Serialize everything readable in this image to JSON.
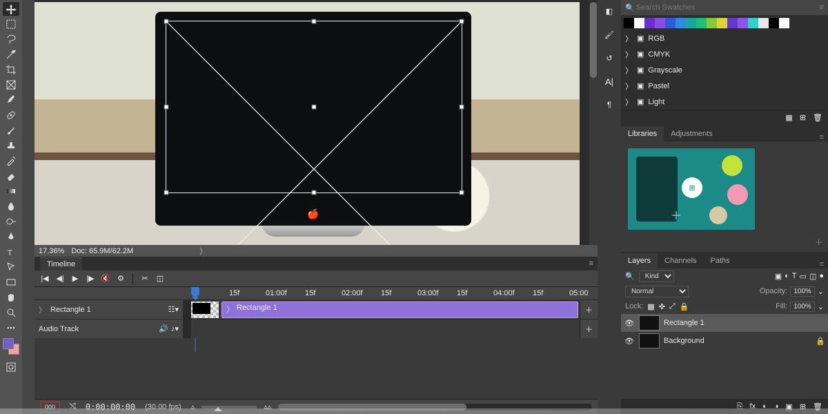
{
  "canvas": {
    "zoom": "17.36%",
    "doc_size": "Doc: 65.9M/62.2M"
  },
  "timeline": {
    "tab": "Timeline",
    "ruler": [
      "15f",
      "01:00f",
      "15f",
      "02:00f",
      "15f",
      "03:00f",
      "15f",
      "04:00f",
      "15f",
      "05:00"
    ],
    "track1": {
      "name": "Rectangle 1",
      "clip": "Rectangle 1"
    },
    "track2": {
      "name": "Audio Track"
    },
    "footer": {
      "frame_btn": "000",
      "timecode": "0:00:00:00",
      "fps": "(30.00 fps)"
    }
  },
  "swatches": {
    "search_placeholder": "Search Swatches",
    "folders": [
      "RGB",
      "CMYK",
      "Grayscale",
      "Pastel",
      "Light"
    ],
    "colors": [
      "#000000",
      "#ffffff",
      "#6a2fcf",
      "#8a4be0",
      "#2d5bd9",
      "#2f8ae0",
      "#17a7a2",
      "#1fbf7a",
      "#86c93e",
      "#e0d23a",
      "#6438cf",
      "#8f55e6",
      "#2cd3cc",
      "#e7e7e7",
      "#000000",
      "#ffffff"
    ]
  },
  "libraries": {
    "tabs": [
      "Libraries",
      "Adjustments"
    ]
  },
  "layers": {
    "tabs": [
      "Layers",
      "Channels",
      "Paths"
    ],
    "kind_placeholder": "Kind",
    "blend": "Normal",
    "opacity_label": "Opacity:",
    "opacity": "100%",
    "lock_label": "Lock:",
    "fill_label": "Fill:",
    "fill": "100%",
    "items": [
      {
        "name": "Rectangle 1",
        "selected": true,
        "locked": false
      },
      {
        "name": "Background",
        "selected": false,
        "locked": true
      }
    ]
  }
}
